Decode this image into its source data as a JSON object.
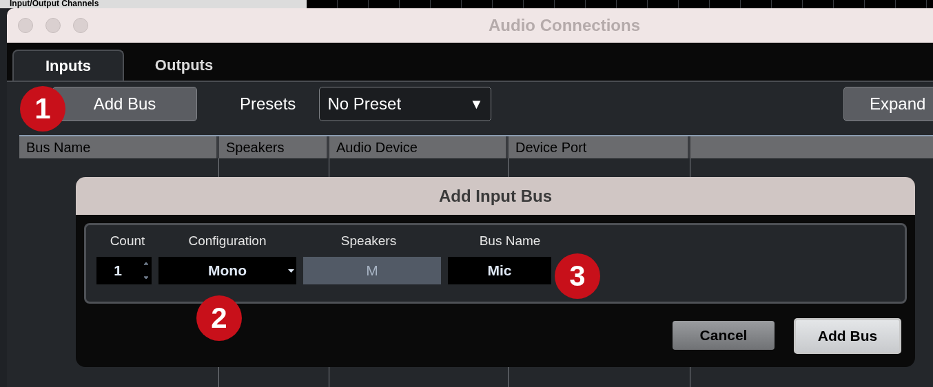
{
  "background_window": {
    "title": "Input/Output Channels"
  },
  "window": {
    "title": "Audio Connections"
  },
  "tabs": [
    {
      "label": "Inputs",
      "selected": true
    },
    {
      "label": "Outputs",
      "selected": false
    }
  ],
  "toolbar": {
    "add_button": "Add Bus",
    "presets_label": "Presets",
    "preset": "No Preset",
    "preset_arrow": "▼",
    "expand_button": "Expand"
  },
  "table": {
    "columns": [
      "Bus Name",
      "Speakers",
      "Audio Device",
      "Device Port"
    ]
  },
  "dialog": {
    "title": "Add Input Bus",
    "labels": [
      "Count",
      "Configuration",
      "Speakers",
      "Bus Name"
    ],
    "count": "1",
    "configuration": "Mono",
    "speakers": "M",
    "bus_name": "Mic",
    "buttons": [
      {
        "label": "Cancel",
        "default": false
      },
      {
        "label": "Add Bus",
        "default": true
      }
    ]
  },
  "callouts": [
    "1",
    "2",
    "3"
  ]
}
